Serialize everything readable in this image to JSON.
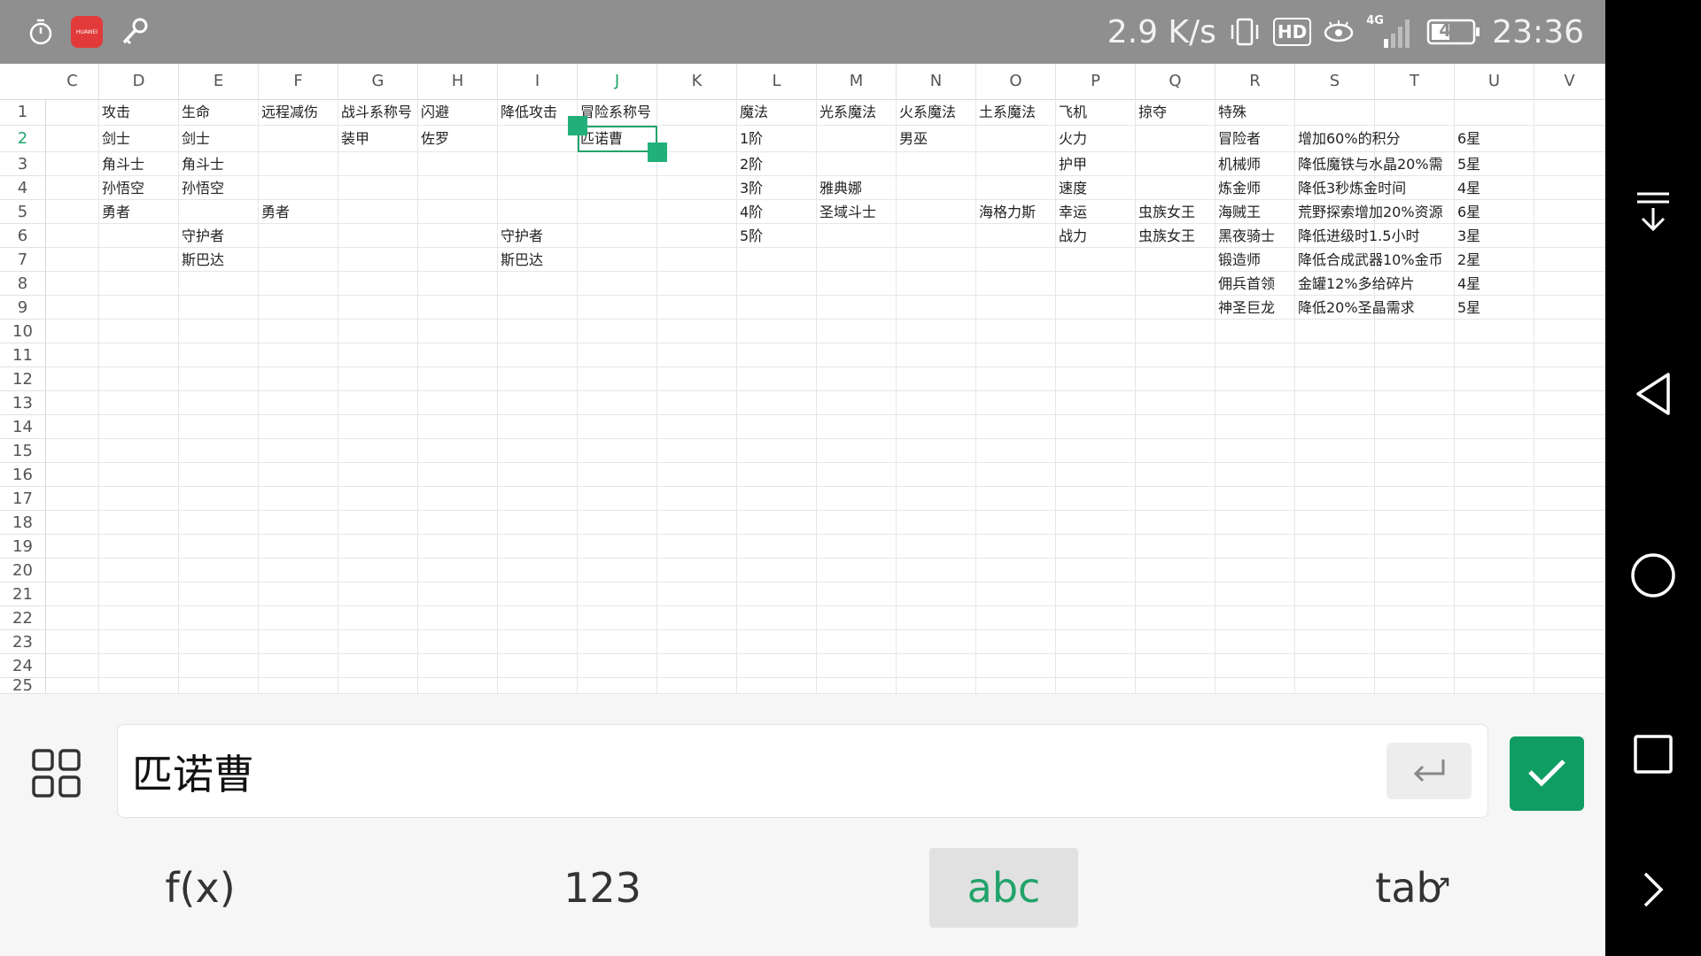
{
  "status_bar": {
    "network_speed": "2.9 K/s",
    "hd_label": "HD",
    "network_type": "4G",
    "battery_level": "41",
    "time": "23:36",
    "app_icon_label": "HUAWEI"
  },
  "sheet": {
    "columns": [
      "C",
      "D",
      "E",
      "F",
      "G",
      "H",
      "I",
      "J",
      "K",
      "L",
      "M",
      "N",
      "O",
      "P",
      "Q",
      "R",
      "S",
      "T",
      "U",
      "V"
    ],
    "active_column": "J",
    "rows": [
      "1",
      "2",
      "3",
      "4",
      "5",
      "6",
      "7",
      "8",
      "9",
      "10",
      "11",
      "12",
      "13",
      "14",
      "15",
      "16",
      "17",
      "18",
      "19",
      "20",
      "21",
      "22",
      "23",
      "24",
      "25"
    ],
    "active_row": "2",
    "cells": {
      "D1": "攻击",
      "E1": "生命",
      "F1": "远程减伤",
      "G1": "战斗系称号",
      "H1": "闪避",
      "I1": "降低攻击",
      "J1": "冒险系称号",
      "L1": "魔法",
      "M1": "光系魔法",
      "N1": "火系魔法",
      "O1": "土系魔法",
      "P1": "飞机",
      "Q1": "掠夺",
      "R1": "特殊",
      "D2": "剑士",
      "E2": "剑士",
      "G2": "装甲",
      "H2": "佐罗",
      "J2": "匹诺曹",
      "L2": "1阶",
      "N2": "男巫",
      "P2": "火力",
      "R2": "冒险者",
      "S2": "增加60%的积分",
      "U2": "6星",
      "D3": "角斗士",
      "E3": "角斗士",
      "L3": "2阶",
      "P3": "护甲",
      "R3": "机械师",
      "S3": "降低魔铁与水晶20%需",
      "U3": "5星",
      "D4": "孙悟空",
      "E4": "孙悟空",
      "L4": "3阶",
      "M4": "雅典娜",
      "P4": "速度",
      "R4": "炼金师",
      "S4": "降低3秒炼金时间",
      "U4": "4星",
      "D5": "勇者",
      "F5": "勇者",
      "L5": "4阶",
      "M5": "圣域斗士",
      "O5": "海格力斯",
      "P5": "幸运",
      "Q5": "虫族女王",
      "R5": "海贼王",
      "S5": "荒野探索增加20%资源",
      "U5": "6星",
      "E6": "守护者",
      "I6": "守护者",
      "L6": "5阶",
      "P6": "战力",
      "Q6": "虫族女王",
      "R6": "黑夜骑士",
      "S6": "降低进级时1.5小时",
      "U6": "3星",
      "E7": "斯巴达",
      "I7": "斯巴达",
      "R7": "锻造师",
      "S7": "降低合成武器10%金币",
      "U7": "2星",
      "R8": "佣兵首领",
      "S8": "金罐12%多给碎片",
      "U8": "4星",
      "R9": "神圣巨龙",
      "S9": "降低20%圣晶需求",
      "U9": "5星"
    }
  },
  "formula_bar": {
    "value": "匹诺曹"
  },
  "keyboard_tabs": {
    "fx": "f(x)",
    "num": "123",
    "abc": "abc",
    "tab": "tab"
  },
  "icons": {
    "grid": "apps-grid-icon",
    "enter": "enter-icon",
    "confirm": "check-icon"
  },
  "colors": {
    "accent": "#21a36a",
    "confirm": "#0f9d64",
    "status_bar": "#8f8f8f"
  }
}
